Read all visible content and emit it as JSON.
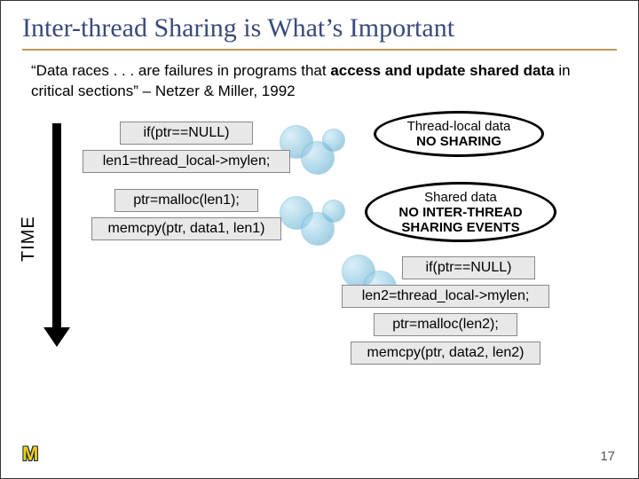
{
  "title": "Inter-thread Sharing is What’s Important",
  "quote": {
    "pre": "“Data races . . . are failures in programs that ",
    "bold1": "access and update shared data",
    "mid": " in critical sections” – Netzer & Miller, 1992"
  },
  "time_label": "TIME",
  "thread1": {
    "c1": "if(ptr==NULL)",
    "c2": "len1=thread_local->mylen;",
    "c3": "ptr=malloc(len1);",
    "c4": "memcpy(ptr, data1, len1)"
  },
  "thread2": {
    "c1": "if(ptr==NULL)",
    "c2": "len2=thread_local->mylen;",
    "c3": "ptr=malloc(len2);",
    "c4": "memcpy(ptr, data2, len2)"
  },
  "callout1": {
    "l1": "Thread-local data",
    "l2": "NO SHARING"
  },
  "callout2": {
    "l1": "Shared data",
    "l2a": "NO INTER-THREAD",
    "l2b": "SHARING EVENTS"
  },
  "logo": "M",
  "page": "17"
}
